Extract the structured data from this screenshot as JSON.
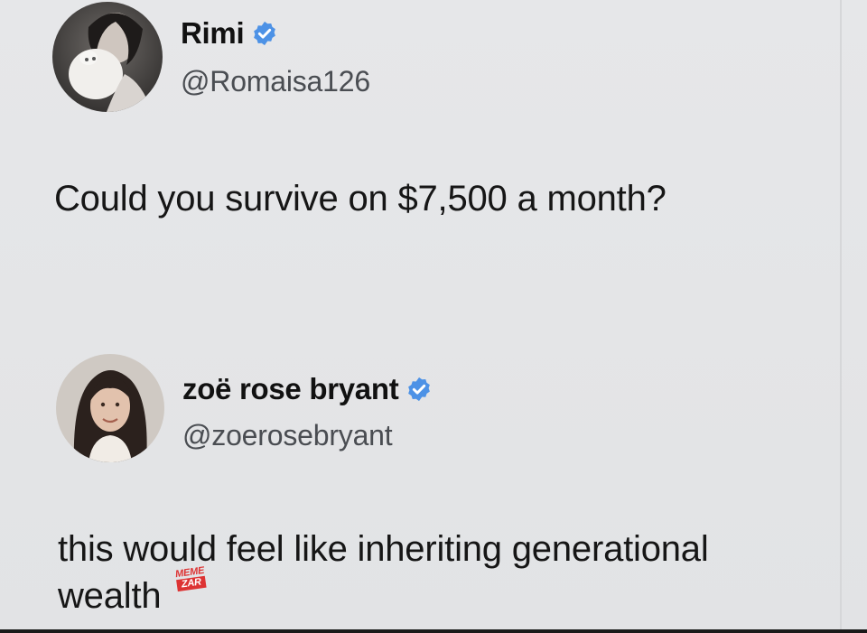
{
  "thread": {
    "tweet1": {
      "display_name": "Rimi",
      "handle": "@Romaisa126",
      "verified": true,
      "text": "Could you survive on $7,500 a month?"
    },
    "tweet2": {
      "display_name": "zoë rose bryant",
      "handle": "@zoerosebryant",
      "verified": true,
      "text_line1": "this would feel like inheriting generational",
      "text_line2": "wealth"
    }
  },
  "watermark": {
    "top": "MEME",
    "bottom": "ZAR"
  },
  "colors": {
    "verified_badge": "#4d92e6",
    "background": "#e4e5e7",
    "text": "#161616",
    "handle": "#4a4d52",
    "watermark": "#dd3333"
  }
}
